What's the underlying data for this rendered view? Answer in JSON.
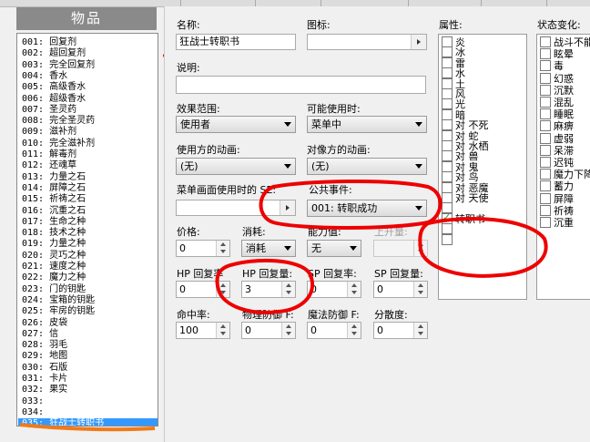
{
  "window": {
    "title": "物品"
  },
  "item_list": {
    "rows": [
      "001: 回复剂",
      "002: 超回复剂",
      "003: 完全回复剂",
      "004: 香水",
      "005: 高级香水",
      "006: 超级香水",
      "007: 圣灵药",
      "008: 完全圣灵药",
      "009: 滋补剂",
      "010: 完全滋补剂",
      "011: 解毒剂",
      "012: 还魂草",
      "013: 力量之石",
      "014: 屏障之石",
      "015: 祈祷之石",
      "016: 沉重之石",
      "017: 生命之种",
      "018: 技术之种",
      "019: 力量之种",
      "020: 灵巧之种",
      "021: 速度之种",
      "022: 魔力之种",
      "023: 门的钥匙",
      "024: 宝箱的钥匙",
      "025: 牢房的钥匙",
      "026: 皮袋",
      "027: 信",
      "028: 羽毛",
      "029: 地图",
      "030: 石版",
      "031: 卡片",
      "032: 果实",
      "033:",
      "034:",
      "035: 狂战士转职书"
    ],
    "selected_index": 34
  },
  "form": {
    "name_label": "名称:",
    "name_value": "狂战士转职书",
    "icon_label": "图标:",
    "desc_label": "说明:",
    "scope_label": "效果范围:",
    "scope_value": "使用者",
    "usable_label": "可能使用时:",
    "usable_value": "菜单中",
    "user_anim_label": "使用方的动画:",
    "user_anim_value": "(无)",
    "target_anim_label": "对像方的动画:",
    "target_anim_value": "(无)",
    "menu_se_label": "菜单画面使用时的 SE:",
    "common_event_label": "公共事件:",
    "common_event_value": "001: 转职成功",
    "price_label": "价格:",
    "price_value": "0",
    "consume_label": "消耗:",
    "consume_value": "消耗",
    "param_label": "能力值:",
    "param_value": "无",
    "param_up_label": "上升量:",
    "hp_rate_label": "HP 回复率",
    "hp_rate_value": "0",
    "hp_amt_label": "HP 回复量:",
    "hp_amt_value": "3",
    "sp_rate_label": "SP 回复率:",
    "sp_rate_value": "0",
    "sp_amt_label": "SP 回复量:",
    "sp_amt_value": "0",
    "hit_label": "命中率:",
    "hit_value": "100",
    "pdef_label": "物理防御 F:",
    "pdef_value": "0",
    "mdef_label": "魔法防御 F:",
    "mdef_value": "0",
    "var_label": "分散度:",
    "var_value": "0"
  },
  "attributes": {
    "label": "属性:",
    "items": [
      {
        "text": "炎",
        "checked": false
      },
      {
        "text": "冰",
        "checked": false
      },
      {
        "text": "雷",
        "checked": false
      },
      {
        "text": "水",
        "checked": false
      },
      {
        "text": "土",
        "checked": false
      },
      {
        "text": "风",
        "checked": false
      },
      {
        "text": "光",
        "checked": false
      },
      {
        "text": "暗",
        "checked": false
      },
      {
        "text": "对 不死",
        "checked": false
      },
      {
        "text": "对 蛇",
        "checked": false
      },
      {
        "text": "对 水栖",
        "checked": false
      },
      {
        "text": "对 兽",
        "checked": false
      },
      {
        "text": "对 鬼",
        "checked": false
      },
      {
        "text": "对 鸟",
        "checked": false
      },
      {
        "text": "对 恶魔",
        "checked": false
      },
      {
        "text": "对 天使",
        "checked": false
      },
      {
        "text": "",
        "checked": false
      },
      {
        "text": "转职书",
        "checked": true
      },
      {
        "text": "",
        "checked": false
      },
      {
        "text": "",
        "checked": false
      }
    ]
  },
  "states": {
    "label": "状态变化:",
    "items": [
      "战斗不能",
      "眩晕",
      "毒",
      "幻惑",
      "沉默",
      "混乱",
      "睡眠",
      "麻痹",
      "虚弱",
      "呆滞",
      "迟钝",
      "魔力下降",
      "蓄力",
      "屏障",
      "祈祷",
      "沉重"
    ]
  },
  "colors": {
    "annotation": "#ee0000",
    "underline": "#f07a1a",
    "selection": "#3399ff"
  }
}
